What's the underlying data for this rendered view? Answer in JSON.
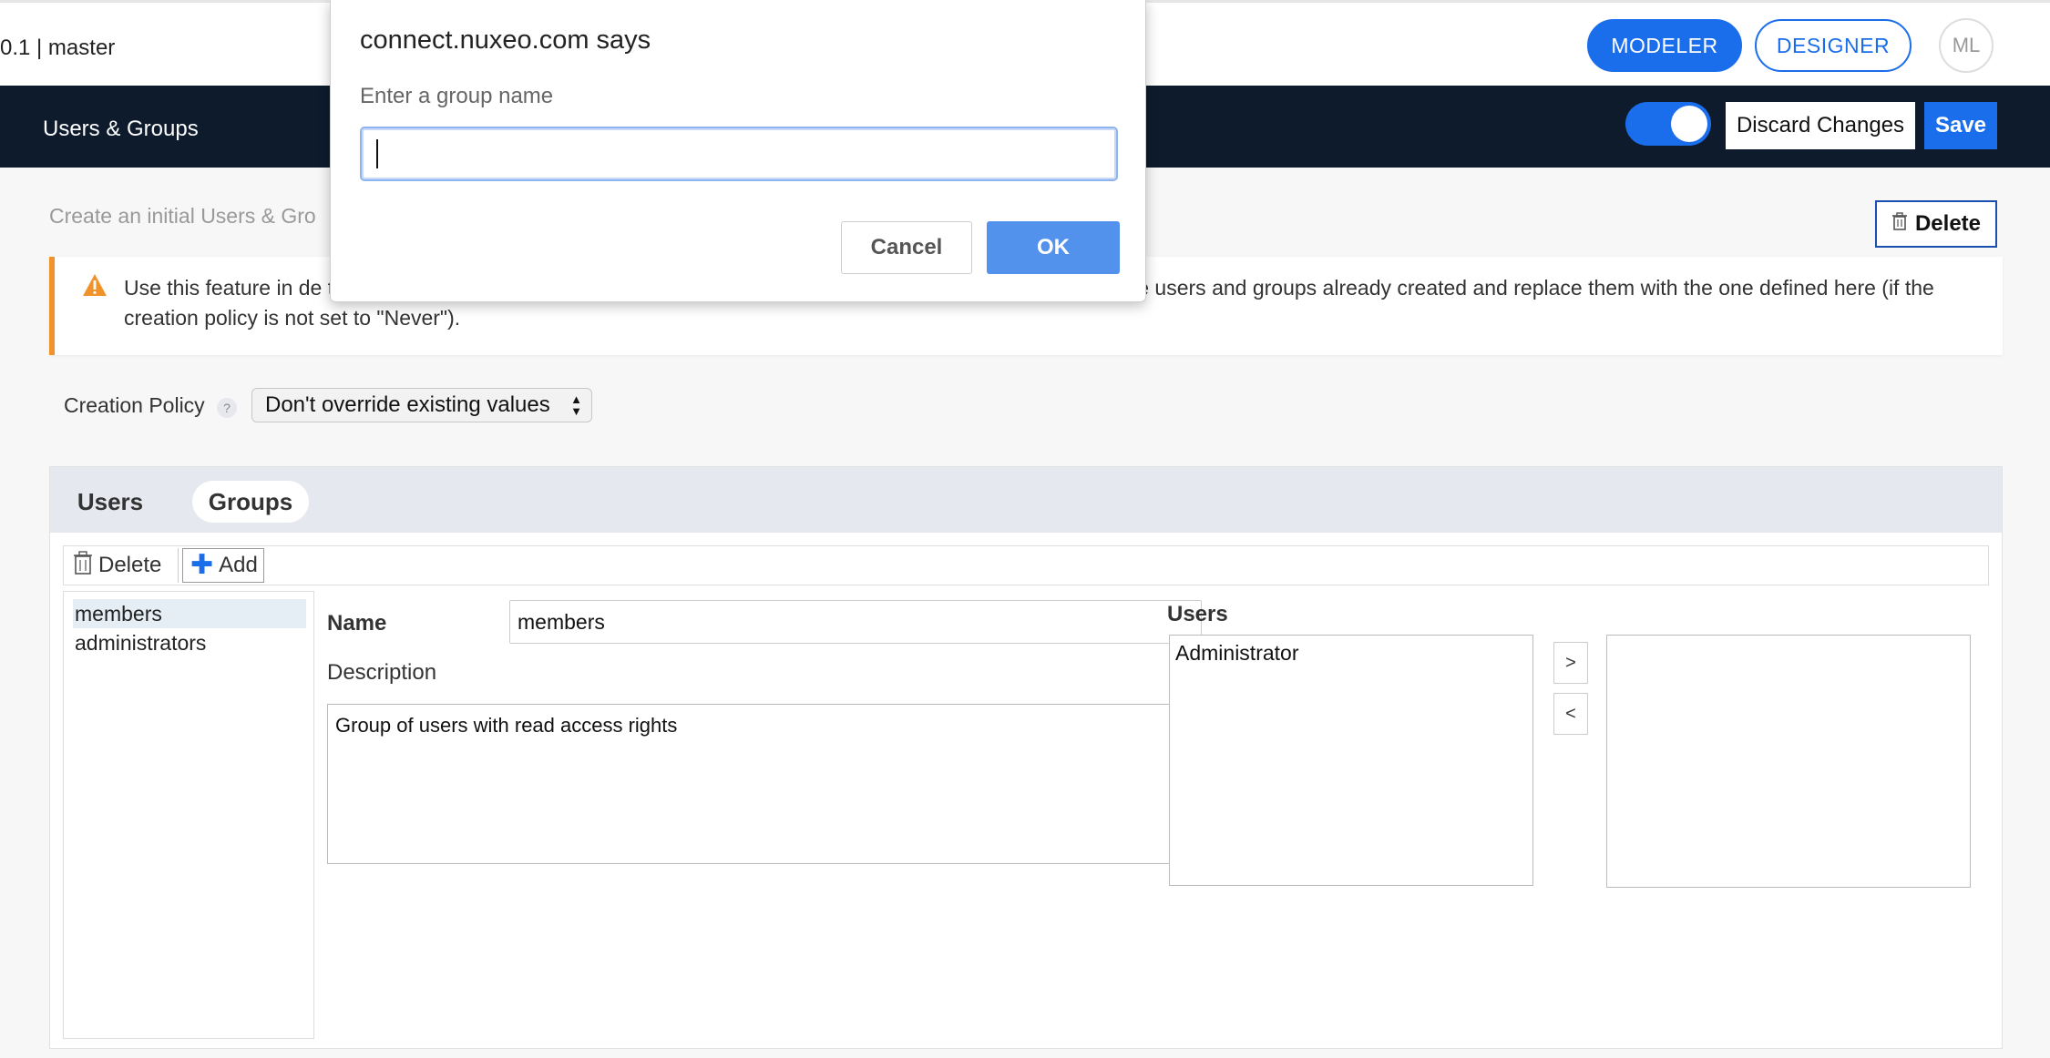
{
  "header": {
    "version_text": "0.1  |  master",
    "modeler_label": "MODELER",
    "designer_label": "DESIGNER",
    "avatar_initials": "ML"
  },
  "nav": {
    "title": "Users & Groups",
    "toggle_on": true,
    "discard_label": "Discard Changes",
    "save_label": "Save"
  },
  "content": {
    "subtitle": "Create an initial Users & Gro",
    "delete_label": "Delete",
    "warning_text": "Use this feature in de                                                                                                                                      to production, otherwise you might either break your authentication system or lose all the users and groups already created and replace them with the one defined here (if the creation policy is not set to \"Never\").",
    "policy_label": "Creation Policy",
    "policy_help": "?",
    "policy_value": "Don't override existing values"
  },
  "panel": {
    "tabs": [
      {
        "label": "Users"
      },
      {
        "label": "Groups"
      }
    ],
    "toolbar": {
      "delete_label": "Delete",
      "add_label": "Add"
    },
    "groups": [
      {
        "label": "members",
        "selected": true
      },
      {
        "label": "administrators",
        "selected": false
      }
    ],
    "form": {
      "name_label": "Name",
      "name_value": "members",
      "description_label": "Description",
      "description_value": "Group of users with read access rights",
      "users_label": "Users",
      "selected_users": [
        "Administrator"
      ],
      "move_right": ">",
      "move_left": "<"
    }
  },
  "dialog": {
    "title": "connect.nuxeo.com says",
    "prompt": "Enter a group name",
    "input_value": "",
    "cancel_label": "Cancel",
    "ok_label": "OK"
  },
  "colors": {
    "accent": "#1a6eec",
    "nav_bg": "#0d1b2d",
    "warning": "#f0932b",
    "dialog_ok": "#5291ec"
  }
}
